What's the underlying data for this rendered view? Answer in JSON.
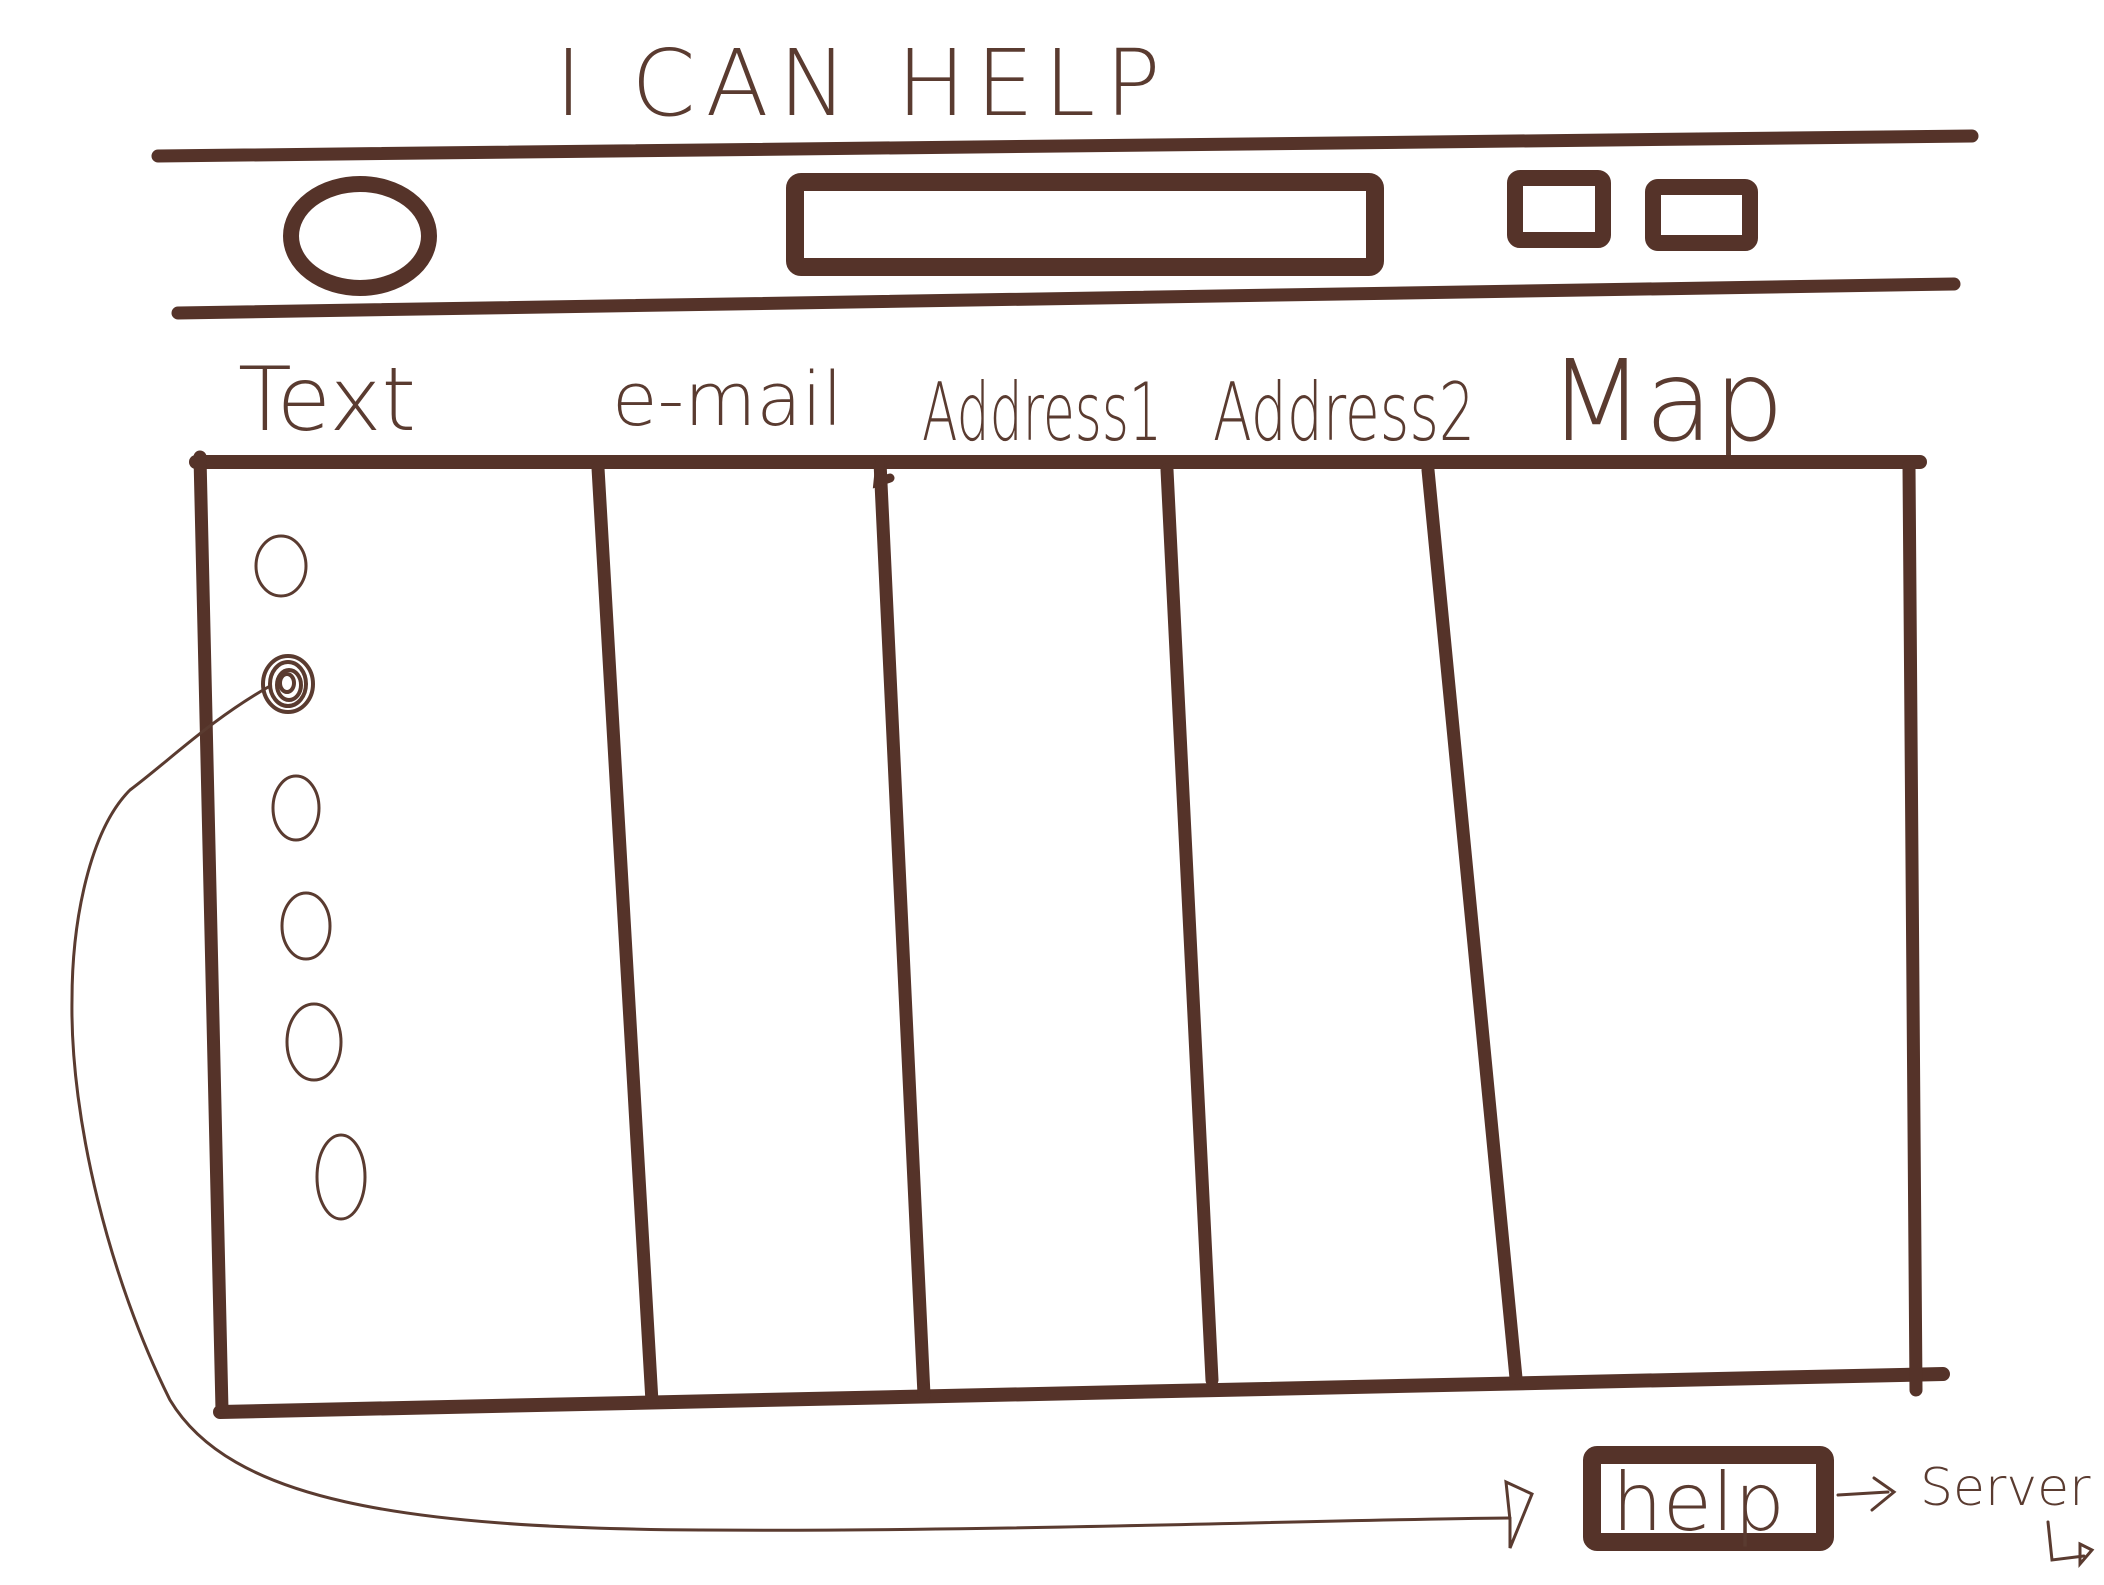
{
  "title": "I CAN HELP",
  "columns": [
    {
      "label": "Text"
    },
    {
      "label": "e-mail"
    },
    {
      "label": "Address1"
    },
    {
      "label": "Address2"
    },
    {
      "label": "Map"
    }
  ],
  "help_button": {
    "label": "help"
  },
  "server_label": "Server",
  "colors": {
    "ink": "#553329",
    "background": "#ffffff"
  }
}
